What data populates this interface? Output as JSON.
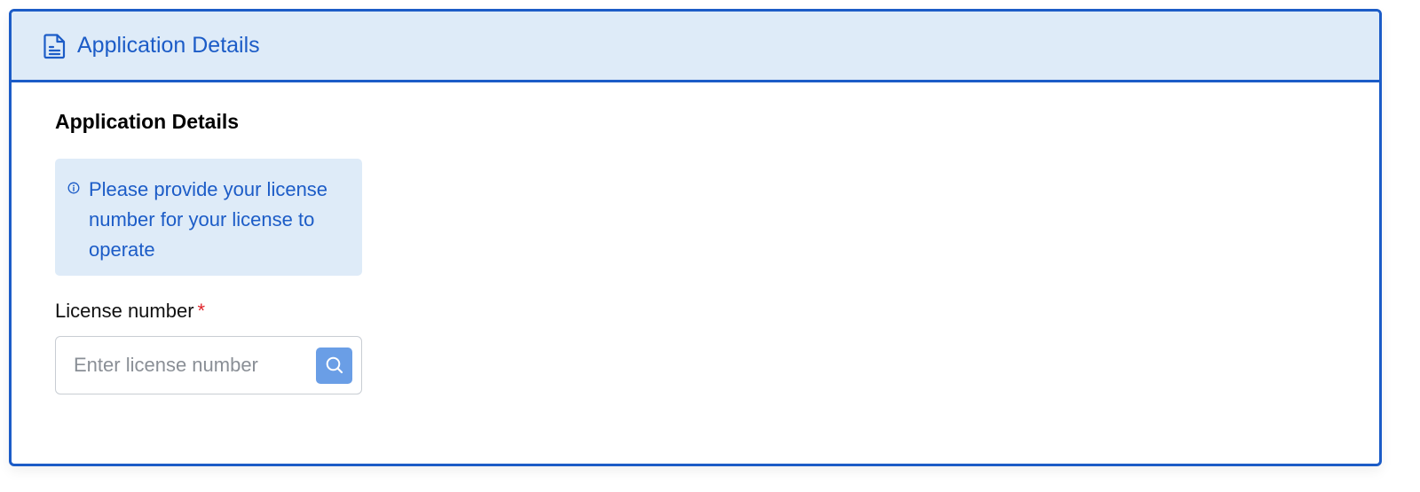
{
  "card": {
    "header_title": "Application Details",
    "header_icon": "document-icon"
  },
  "section": {
    "title": "Application Details"
  },
  "info": {
    "icon": "info-icon",
    "message": "Please provide your license number for your license to operate"
  },
  "license_field": {
    "label": "License number",
    "required_marker": "*",
    "value": "",
    "placeholder": "Enter license number",
    "search_icon": "search-icon"
  },
  "colors": {
    "accent": "#1c5cc7",
    "header_bg": "#deebf8",
    "info_bg": "#deebf8",
    "search_button": "#6a9ee6",
    "required": "#e0242a"
  }
}
